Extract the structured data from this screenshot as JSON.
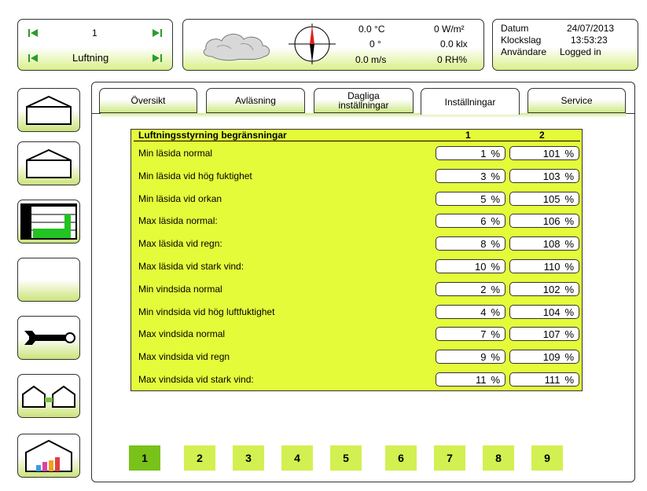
{
  "top_nav": {
    "number": "1",
    "section": "Luftning"
  },
  "weather": {
    "temperature": "0.0 °C",
    "direction": "0 °",
    "wind_speed": "0.0 m/s",
    "radiation": "0 W/m²",
    "light": "0.0 klx",
    "humidity": "0 RH%"
  },
  "info": {
    "date_label": "Datum",
    "date_value": "24/07/2013",
    "time_label": "Klockslag",
    "time_value": "13:53:23",
    "user_label": "Användare",
    "user_value": "Logged in"
  },
  "tabs": [
    {
      "label": "Översikt"
    },
    {
      "label": "Avläsning"
    },
    {
      "label": "Dagliga inställningar"
    },
    {
      "label": "Inställningar"
    },
    {
      "label": "Service"
    }
  ],
  "table": {
    "title": "Luftningsstyrning begränsningar",
    "col1": "1",
    "col2": "2",
    "unit": "%",
    "rows": [
      {
        "label": "Min läsida normal",
        "v1": "1",
        "v2": "101"
      },
      {
        "label": "Min läsida vid hög fuktighet",
        "v1": "3",
        "v2": "103"
      },
      {
        "label": "Min läsida vid orkan",
        "v1": "5",
        "v2": "105"
      },
      {
        "label": "Max läsida normal:",
        "v1": "6",
        "v2": "106"
      },
      {
        "label": "Max läsida vid regn:",
        "v1": "8",
        "v2": "108"
      },
      {
        "label": "Max läsida vid stark vind:",
        "v1": "10",
        "v2": "110"
      },
      {
        "label": "Min vindsida normal",
        "v1": "2",
        "v2": "102"
      },
      {
        "label": "Min vindsida vid hög luftfuktighet",
        "v1": "4",
        "v2": "104"
      },
      {
        "label": "Max vindsida normal",
        "v1": "7",
        "v2": "107"
      },
      {
        "label": "Max vindsida vid regn",
        "v1": "9",
        "v2": "109"
      },
      {
        "label": "Max vindsida vid stark vind:",
        "v1": "11",
        "v2": "111"
      }
    ]
  },
  "pages": [
    "1",
    "2",
    "3",
    "4",
    "5",
    "6",
    "7",
    "8",
    "9"
  ],
  "active_page": "1",
  "colors": {
    "accent": "#e4fb3a",
    "active_page": "#79c21a",
    "page_button": "#d2f051"
  }
}
